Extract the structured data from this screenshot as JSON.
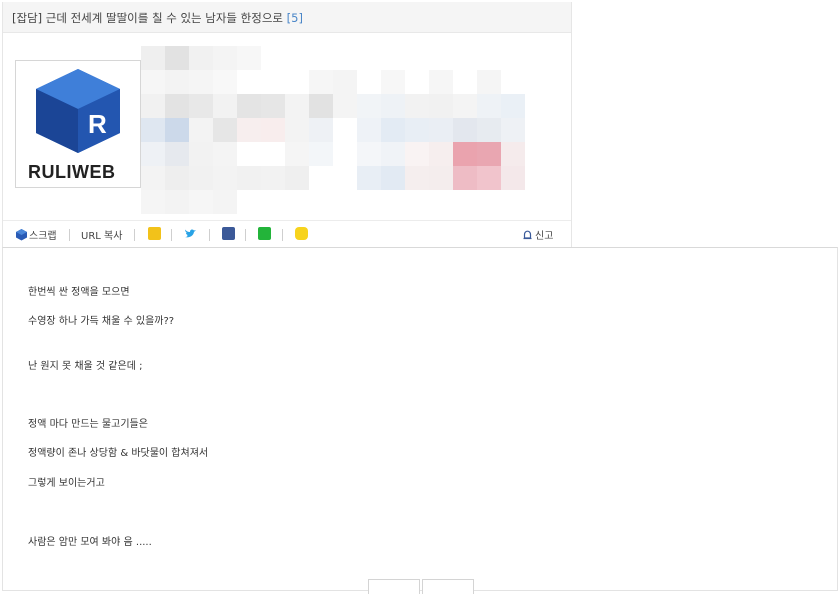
{
  "post": {
    "title": "[잡담] 근데 전세계 딸딸이를 칠 수 있는 남자들 한정으로",
    "comment_count": "[5]"
  },
  "logo": {
    "text": "RULIWEB",
    "icon": "ruliweb-logo-icon"
  },
  "share_bar": {
    "scrap_label": "스크랩",
    "url_copy_label": "URL 복사",
    "report_label": "신고",
    "icons": [
      "kakaostory-icon",
      "twitter-icon",
      "facebook-icon",
      "naver-icon",
      "kakaotalk-icon"
    ]
  },
  "body": {
    "lines": [
      "한번씩 싼 정액을 모으면",
      "수영장 하나 가득 채울 수 있을까??",
      "난 원지 못 채울 것 같은데 ;",
      "정액 마다 만드는 물고기들은",
      "정액량이 존나 상당함 & 바닷물이 합쳐져서",
      "그렇게 보이는거고",
      "사람은 암만 모여 봐야 음 ....."
    ]
  },
  "colors": {
    "title_bg": "#f5f5f5",
    "count": "#4a86c8",
    "logo_blue": "#1d4fa3"
  }
}
